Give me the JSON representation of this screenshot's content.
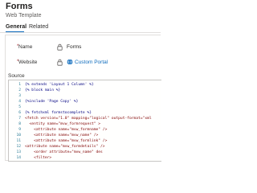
{
  "header": {
    "title": "Forms",
    "subtitle": "Web Template"
  },
  "tabs": [
    {
      "label": "General"
    },
    {
      "label": "Related"
    }
  ],
  "fields": {
    "name": {
      "label": "Name",
      "value": "Forms"
    },
    "website": {
      "label": "Website",
      "value": "Custom Portal"
    }
  },
  "source": {
    "label": "Source",
    "lines": [
      {
        "n": "1",
        "text": "{% extends 'Layout 1 Column' %}"
      },
      {
        "n": "2",
        "text": "{% block main %}"
      },
      {
        "n": "3",
        "text": ""
      },
      {
        "n": "4",
        "text": "{%include 'Page Copy' %}"
      },
      {
        "n": "5",
        "text": ""
      },
      {
        "n": "6",
        "text": "{% fetchxml formstocomplete %}"
      },
      {
        "n": "7",
        "text": "<fetch version=\"1.0\" mapping=\"logical\" output-format=\"xml"
      },
      {
        "n": "8",
        "text": "  <entity name=\"mvw_formrequest\" >"
      },
      {
        "n": "9",
        "text": "    <attribute name=\"mvw_formname\" />"
      },
      {
        "n": "10",
        "text": "    <attribute name=\"mvw_name\" />"
      },
      {
        "n": "11",
        "text": "    <attribute name=\"mvw_formlink\" />"
      },
      {
        "n": "12",
        "text": "<attribute name=\"mvw_formdetails\" />"
      },
      {
        "n": "13",
        "text": "    <order attribute=\"mvw_name\" des"
      },
      {
        "n": "14",
        "text": "    <filter>"
      }
    ]
  }
}
